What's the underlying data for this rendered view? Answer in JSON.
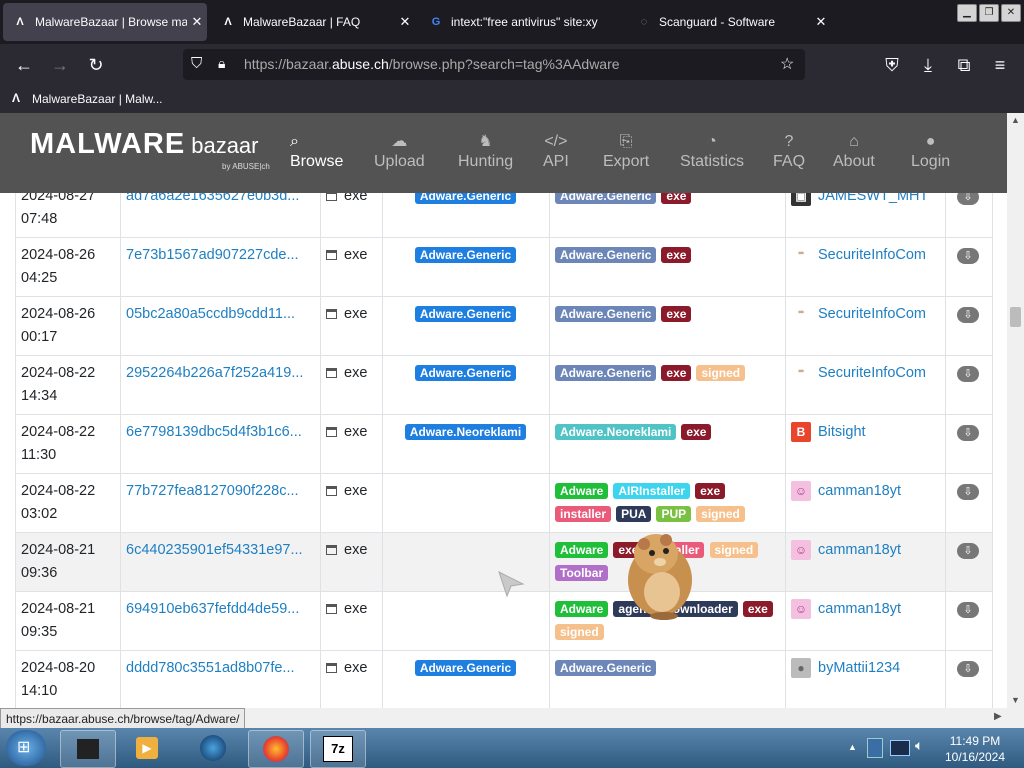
{
  "browser": {
    "tabs": [
      {
        "title": "MalwareBazaar | Browse ma",
        "active": true
      },
      {
        "title": "MalwareBazaar | FAQ",
        "active": false
      },
      {
        "title": "intext:\"free antivirus\" site:xy",
        "active": false
      },
      {
        "title": "Scanguard - Software",
        "active": false
      }
    ],
    "url_prefix": "https://bazaar.",
    "url_domain": "abuse.ch",
    "url_path": "/browse.php?search=tag%3AAdware",
    "bookmark": "MalwareBazaar | Malw..."
  },
  "site": {
    "logo_main": "MALWARE",
    "logo_sub": "bazaar",
    "logo_by": "by ABUSE|ch",
    "menu": [
      {
        "label": "Browse",
        "icon": "search-icon",
        "active": true
      },
      {
        "label": "Upload",
        "icon": "cloud-upload-icon",
        "active": false
      },
      {
        "label": "Hunting",
        "icon": "hunting-icon",
        "active": false
      },
      {
        "label": "API",
        "icon": "code-icon",
        "active": false
      },
      {
        "label": "Export",
        "icon": "export-icon",
        "active": false
      },
      {
        "label": "Statistics",
        "icon": "pie-chart-icon",
        "active": false
      },
      {
        "label": "FAQ",
        "icon": "question-icon",
        "active": false
      },
      {
        "label": "About",
        "icon": "building-icon",
        "active": false
      },
      {
        "label": "Login",
        "icon": "user-icon",
        "active": false
      }
    ]
  },
  "colors": {
    "blue": "#1e7fe0",
    "grayblue": "#6c86b8",
    "darkred": "#8b1a2b",
    "green": "#1fbf3a",
    "cyan": "#3cd4ee",
    "pink": "#ea5b7b",
    "navy": "#2e3a59",
    "lime": "#7ac143",
    "peach": "#f6c08c",
    "purple": "#b06fc9",
    "teal": "#4fc3c6"
  },
  "rows": [
    {
      "date": "2024-08-27",
      "time": "07:48",
      "sha": "ad7a6a2e1635627e0b3d...",
      "type": "exe",
      "signature": "Adware.Generic",
      "tags": [
        [
          "Adware.Generic",
          "grayblue"
        ],
        [
          "exe",
          "darkred"
        ]
      ],
      "reporter": "JAMESWT_MHT",
      "avatar": "jameswt"
    },
    {
      "date": "2024-08-26",
      "time": "04:25",
      "sha": "7e73b1567ad907227cde...",
      "type": "exe",
      "signature": "Adware.Generic",
      "tags": [
        [
          "Adware.Generic",
          "grayblue"
        ],
        [
          "exe",
          "darkred"
        ]
      ],
      "reporter": "SecuriteInfoCom",
      "avatar": "securiteinfo"
    },
    {
      "date": "2024-08-26",
      "time": "00:17",
      "sha": "05bc2a80a5ccdb9cdd11...",
      "type": "exe",
      "signature": "Adware.Generic",
      "tags": [
        [
          "Adware.Generic",
          "grayblue"
        ],
        [
          "exe",
          "darkred"
        ]
      ],
      "reporter": "SecuriteInfoCom",
      "avatar": "securiteinfo"
    },
    {
      "date": "2024-08-22",
      "time": "14:34",
      "sha": "2952264b226a7f252a419...",
      "type": "exe",
      "signature": "Adware.Generic",
      "tags": [
        [
          "Adware.Generic",
          "grayblue"
        ],
        [
          "exe",
          "darkred"
        ],
        [
          "signed",
          "peach"
        ]
      ],
      "reporter": "SecuriteInfoCom",
      "avatar": "securiteinfo"
    },
    {
      "date": "2024-08-22",
      "time": "11:30",
      "sha": "6e7798139dbc5d4f3b1c6...",
      "type": "exe",
      "signature": "Adware.Neoreklami",
      "tags": [
        [
          "Adware.Neoreklami",
          "teal"
        ],
        [
          "exe",
          "darkred"
        ]
      ],
      "reporter": "Bitsight",
      "avatar": "bitsight"
    },
    {
      "date": "2024-08-22",
      "time": "03:02",
      "sha": "77b727fea8127090f228c...",
      "type": "exe",
      "signature": "",
      "tags": [
        [
          "Adware",
          "green"
        ],
        [
          "AIRInstaller",
          "cyan"
        ],
        [
          "exe",
          "darkred"
        ],
        [
          "installer",
          "pink"
        ],
        [
          "PUA",
          "navy"
        ],
        [
          "PUP",
          "lime"
        ],
        [
          "signed",
          "peach"
        ]
      ],
      "reporter": "camman18yt",
      "avatar": "camman"
    },
    {
      "date": "2024-08-21",
      "time": "09:36",
      "sha": "6c440235901ef54331e97...",
      "type": "exe",
      "signature": "",
      "tags": [
        [
          "Adware",
          "green"
        ],
        [
          "exe",
          "darkred"
        ],
        [
          "installer",
          "pink"
        ],
        [
          "signed",
          "peach"
        ],
        [
          "Toolbar",
          "purple"
        ]
      ],
      "reporter": "camman18yt",
      "avatar": "camman",
      "highlight": true
    },
    {
      "date": "2024-08-21",
      "time": "09:35",
      "sha": "694910eb637fefdd4de59...",
      "type": "exe",
      "signature": "",
      "tags": [
        [
          "Adware",
          "green"
        ],
        [
          "agent",
          "navy"
        ],
        [
          "downloader",
          "navy"
        ],
        [
          "exe",
          "darkred"
        ],
        [
          "signed",
          "peach"
        ]
      ],
      "reporter": "camman18yt",
      "avatar": "camman"
    },
    {
      "date": "2024-08-20",
      "time": "14:10",
      "sha": "dddd780c3551ad8b07fe...",
      "type": "exe",
      "signature": "Adware.Generic",
      "tags": [
        [
          "Adware.Generic",
          "grayblue"
        ]
      ],
      "reporter": "byMattii1234",
      "avatar": "default"
    }
  ],
  "status_url": "https://bazaar.abuse.ch/browse/tag/Adware/",
  "taskbar": {
    "time": "11:49 PM",
    "date": "10/16/2024"
  }
}
